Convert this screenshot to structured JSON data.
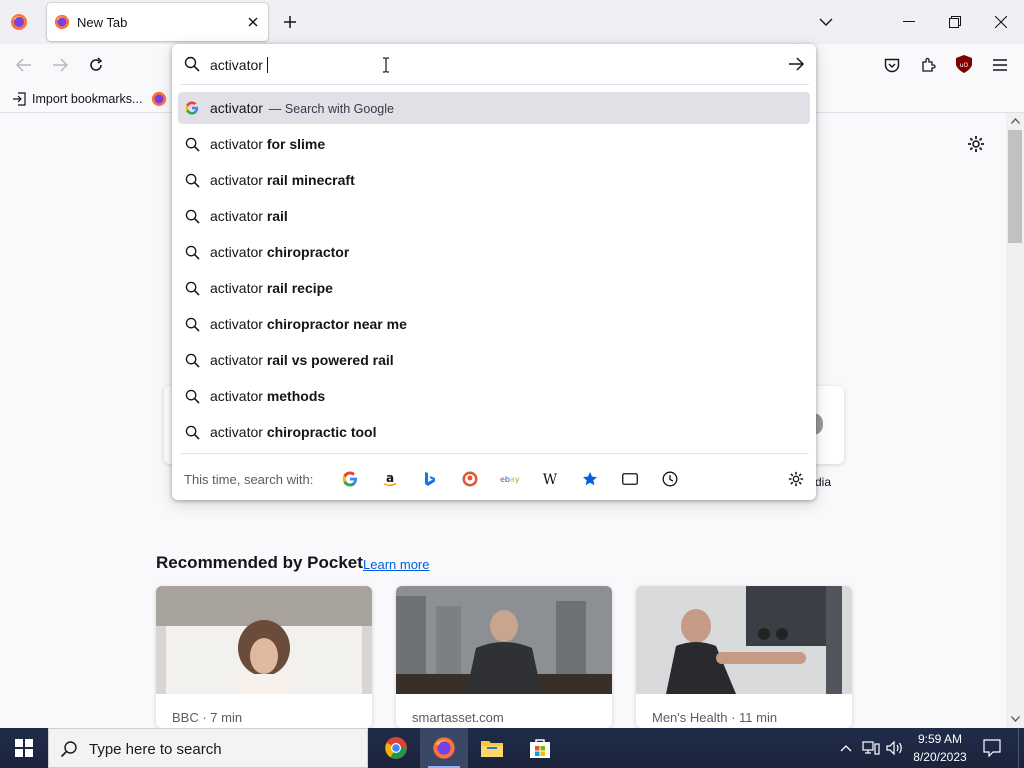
{
  "tab": {
    "title": "New Tab"
  },
  "bookmarks": {
    "import_label": "Import bookmarks..."
  },
  "urlbar": {
    "value": "activator"
  },
  "suggestions": [
    {
      "prefix": "activator",
      "bold": "",
      "suffix": "— Search with Google",
      "selected": true,
      "icon": "google-icon"
    },
    {
      "prefix": "activator",
      "bold": "for slime",
      "suffix": "",
      "selected": false,
      "icon": "search-icon"
    },
    {
      "prefix": "activator",
      "bold": "rail minecraft",
      "suffix": "",
      "selected": false,
      "icon": "search-icon"
    },
    {
      "prefix": "activator",
      "bold": "rail",
      "suffix": "",
      "selected": false,
      "icon": "search-icon"
    },
    {
      "prefix": "activator",
      "bold": "chiropractor",
      "suffix": "",
      "selected": false,
      "icon": "search-icon"
    },
    {
      "prefix": "activator",
      "bold": "rail recipe",
      "suffix": "",
      "selected": false,
      "icon": "search-icon"
    },
    {
      "prefix": "activator",
      "bold": "chiropractor near me",
      "suffix": "",
      "selected": false,
      "icon": "search-icon"
    },
    {
      "prefix": "activator",
      "bold": "rail vs powered rail",
      "suffix": "",
      "selected": false,
      "icon": "search-icon"
    },
    {
      "prefix": "activator",
      "bold": "methods",
      "suffix": "",
      "selected": false,
      "icon": "search-icon"
    },
    {
      "prefix": "activator",
      "bold": "chiropractic tool",
      "suffix": "",
      "selected": false,
      "icon": "search-icon"
    }
  ],
  "oneoff": {
    "label": "This time, search with:",
    "engines": [
      "google-icon",
      "amazon-icon",
      "bing-icon",
      "duckduckgo-icon",
      "ebay-icon",
      "wikipedia-icon",
      "bookmarks-star-icon",
      "tabs-icon",
      "history-icon"
    ]
  },
  "shortcut_partial_label": "dia",
  "pocket": {
    "title": "Recommended by Pocket",
    "learn_more": "Learn more",
    "cards": [
      {
        "source": "BBC · 7 min"
      },
      {
        "source": "smartasset.com"
      },
      {
        "source": "Men's Health · 11 min"
      }
    ]
  },
  "taskbar": {
    "search_placeholder": "Type here to search",
    "time": "9:59 AM",
    "date": "8/20/2023"
  },
  "colors": {
    "accent": "#0061e0",
    "selected_row": "#e0e0e6",
    "taskbar": "#1f2a44"
  }
}
